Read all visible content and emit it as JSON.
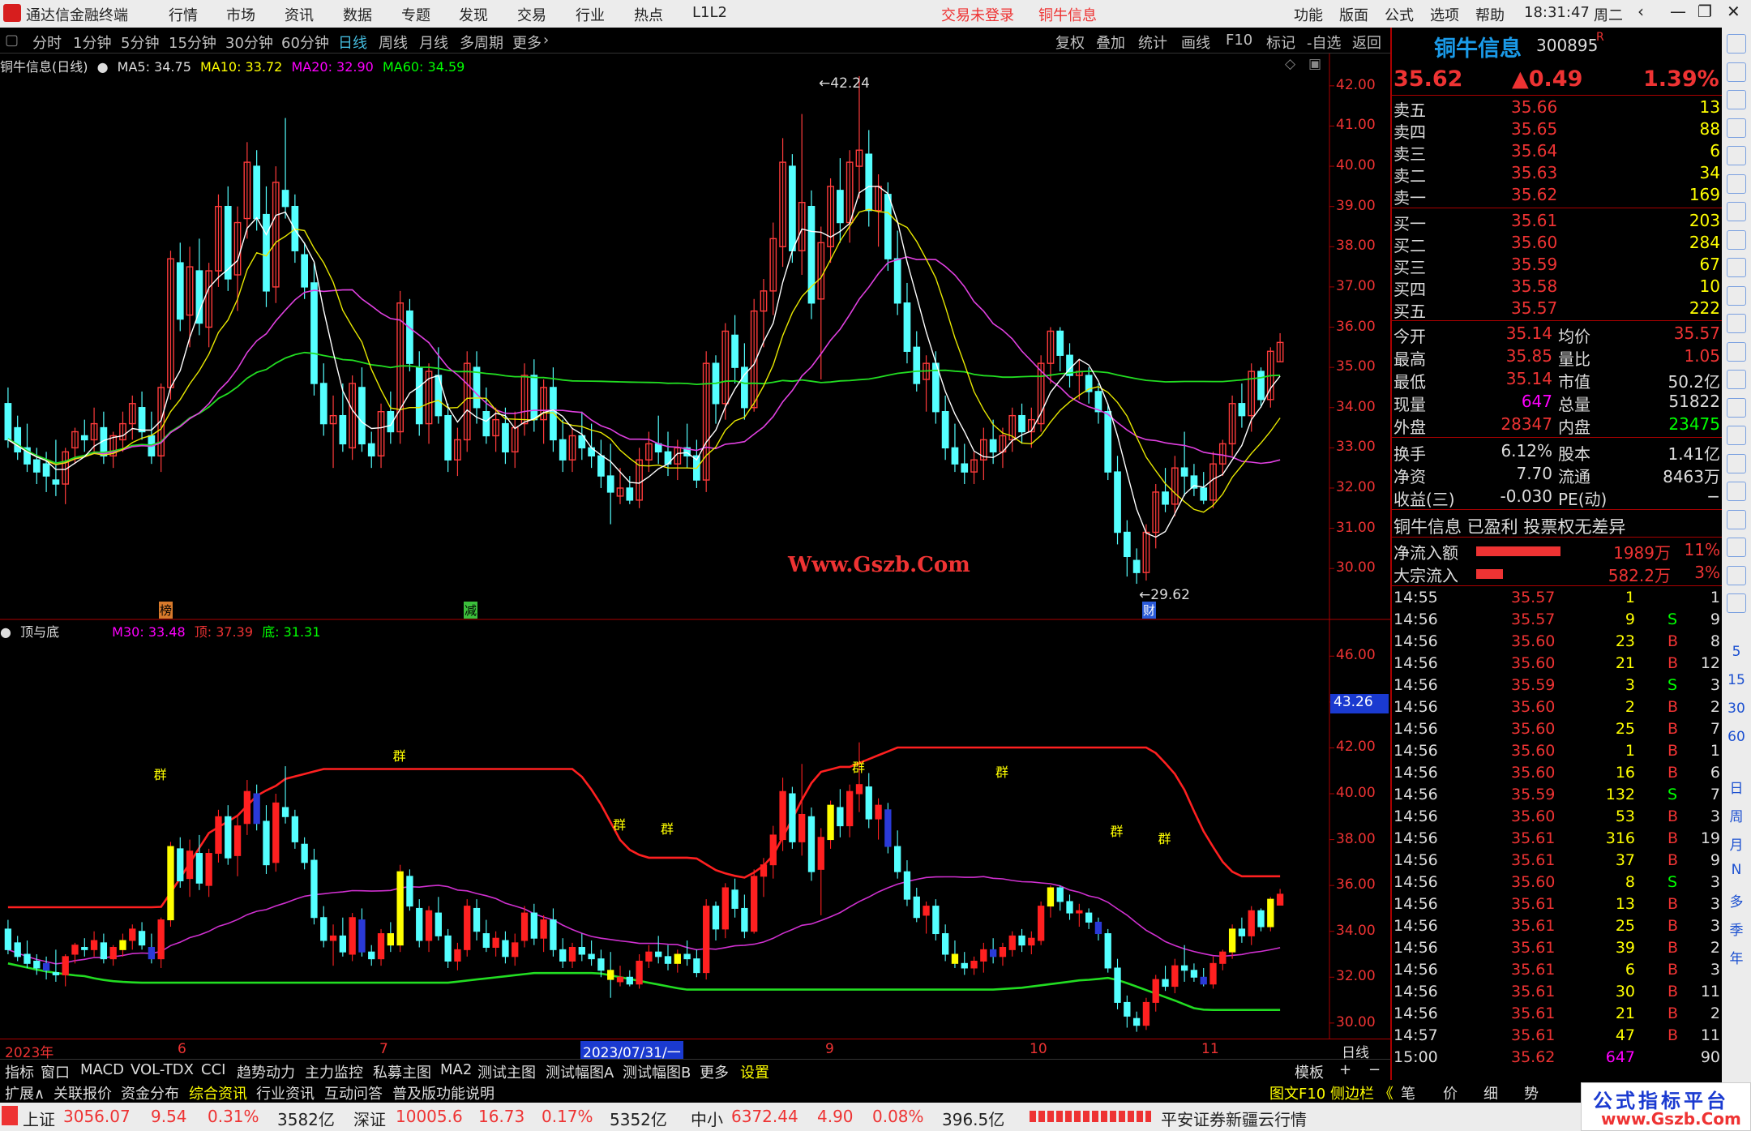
{
  "topbar": {
    "app_title": "通达信金融终端",
    "menu": [
      "行情",
      "市场",
      "资讯",
      "数据",
      "专题",
      "发现",
      "交易",
      "行业",
      "热点",
      "L1L2"
    ],
    "trade_status": "交易未登录",
    "stock_name": "铜牛信息",
    "right_menu": [
      "功能",
      "版面",
      "公式",
      "选项",
      "帮助"
    ],
    "time": "18:31:47",
    "weekday": "周二"
  },
  "periodbar": {
    "periods": [
      "分时",
      "1分钟",
      "5分钟",
      "15分钟",
      "30分钟",
      "60分钟",
      "日线",
      "周线",
      "月线",
      "多周期",
      "更多"
    ],
    "active": "日线",
    "tools": [
      "复权",
      "叠加",
      "统计",
      "画线",
      "F10",
      "标记",
      "-自选",
      "返回"
    ]
  },
  "main_chart": {
    "title": "铜牛信息(日线)",
    "ma5_label": "MA5: 34.75",
    "ma10_label": "MA10: 33.72",
    "ma20_label": "MA20: 32.90",
    "ma60_label": "MA60: 34.59",
    "high_label": "42.24",
    "low_label": "29.62",
    "watermark": "Www.Gszb.Com",
    "marker_bang": "榜",
    "marker_jian": "减",
    "marker_cai": "财",
    "yticks": [
      "42.00",
      "41.00",
      "40.00",
      "39.00",
      "38.00",
      "37.00",
      "36.00",
      "35.00",
      "34.00",
      "33.00",
      "32.00",
      "31.00",
      "30.00"
    ]
  },
  "indicator": {
    "name": "顶与底",
    "m30_label": "M30: 33.48",
    "top_label": "顶: 37.39",
    "bottom_label": "底: 31.31",
    "current_value": "43.26",
    "group_marker": "群",
    "yticks": [
      "46.00",
      "44.00",
      "42.00",
      "40.00",
      "38.00",
      "36.00",
      "34.00",
      "32.00",
      "30.00"
    ]
  },
  "xaxis": {
    "labels": [
      "2023年",
      "6",
      "7",
      "2023/07/31/一",
      "9",
      "10",
      "11"
    ],
    "period_label": "日线"
  },
  "tabs1": {
    "items": [
      "指标",
      "窗口",
      "MACD",
      "VOL-TDX",
      "CCI",
      "趋势动力",
      "主力监控",
      "私募主图",
      "MA2",
      "测试主图",
      "测试幅图A",
      "测试幅图B",
      "更多",
      "设置"
    ],
    "right": [
      "模板",
      "+",
      "−"
    ]
  },
  "tabs2": {
    "items": [
      "扩展∧",
      "关联报价",
      "资金分布",
      "综合资讯",
      "行业资讯",
      "互动问答",
      "普及版功能说明"
    ],
    "right": "图文F10 侧边栏 《",
    "quote_tabs": [
      "笔",
      "价",
      "细",
      "势"
    ]
  },
  "quote": {
    "name": "铜牛信息",
    "code": "300895",
    "flag": "R",
    "price": "35.62",
    "change": "▲0.49",
    "change_pct": "1.39%",
    "asks": [
      {
        "label": "卖五",
        "price": "35.66",
        "vol": "13"
      },
      {
        "label": "卖四",
        "price": "35.65",
        "vol": "88"
      },
      {
        "label": "卖三",
        "price": "35.64",
        "vol": "6"
      },
      {
        "label": "卖二",
        "price": "35.63",
        "vol": "34"
      },
      {
        "label": "卖一",
        "price": "35.62",
        "vol": "169"
      }
    ],
    "bids": [
      {
        "label": "买一",
        "price": "35.61",
        "vol": "203"
      },
      {
        "label": "买二",
        "price": "35.60",
        "vol": "284"
      },
      {
        "label": "买三",
        "price": "35.59",
        "vol": "67"
      },
      {
        "label": "买四",
        "price": "35.58",
        "vol": "10"
      },
      {
        "label": "买五",
        "price": "35.57",
        "vol": "222"
      }
    ],
    "stats": [
      {
        "l1": "今开",
        "v1": "35.14",
        "l2": "均价",
        "v2": "35.57"
      },
      {
        "l1": "最高",
        "v1": "35.85",
        "l2": "量比",
        "v2": "1.05"
      },
      {
        "l1": "最低",
        "v1": "35.14",
        "l2": "市值",
        "v2": "50.2亿"
      },
      {
        "l1": "现量",
        "v1": "647",
        "l2": "总量",
        "v2": "51822"
      },
      {
        "l1": "外盘",
        "v1": "28347",
        "l2": "内盘",
        "v2": "23475"
      }
    ],
    "stats2": [
      {
        "l1": "换手",
        "v1": "6.12%",
        "l2": "股本",
        "v2": "1.41亿"
      },
      {
        "l1": "净资",
        "v1": "7.70",
        "l2": "流通",
        "v2": "8463万"
      },
      {
        "l1": "收益(三)",
        "v1": "-0.030",
        "l2": "PE(动)",
        "v2": "−"
      }
    ],
    "tagline": "铜牛信息 已盈利 投票权无差异",
    "flows": [
      {
        "label": "净流入额",
        "value": "1989万",
        "pct": "11%",
        "bar": 0.8
      },
      {
        "label": "大宗流入",
        "value": "582.2万",
        "pct": "3%",
        "bar": 0.25
      }
    ],
    "ticks": [
      {
        "t": "14:55",
        "p": "35.57",
        "v": "1",
        "s": "",
        "n": "1"
      },
      {
        "t": "14:56",
        "p": "35.57",
        "v": "9",
        "s": "S",
        "n": "9"
      },
      {
        "t": "14:56",
        "p": "35.60",
        "v": "23",
        "s": "B",
        "n": "8"
      },
      {
        "t": "14:56",
        "p": "35.60",
        "v": "21",
        "s": "B",
        "n": "12"
      },
      {
        "t": "14:56",
        "p": "35.59",
        "v": "3",
        "s": "S",
        "n": "3"
      },
      {
        "t": "14:56",
        "p": "35.60",
        "v": "2",
        "s": "B",
        "n": "2"
      },
      {
        "t": "14:56",
        "p": "35.60",
        "v": "25",
        "s": "B",
        "n": "7"
      },
      {
        "t": "14:56",
        "p": "35.60",
        "v": "1",
        "s": "B",
        "n": "1"
      },
      {
        "t": "14:56",
        "p": "35.60",
        "v": "16",
        "s": "B",
        "n": "6"
      },
      {
        "t": "14:56",
        "p": "35.59",
        "v": "132",
        "s": "S",
        "n": "7"
      },
      {
        "t": "14:56",
        "p": "35.60",
        "v": "53",
        "s": "B",
        "n": "3"
      },
      {
        "t": "14:56",
        "p": "35.61",
        "v": "316",
        "s": "B",
        "n": "19"
      },
      {
        "t": "14:56",
        "p": "35.61",
        "v": "37",
        "s": "B",
        "n": "9"
      },
      {
        "t": "14:56",
        "p": "35.60",
        "v": "8",
        "s": "S",
        "n": "3"
      },
      {
        "t": "14:56",
        "p": "35.61",
        "v": "13",
        "s": "B",
        "n": "3"
      },
      {
        "t": "14:56",
        "p": "35.61",
        "v": "25",
        "s": "B",
        "n": "3"
      },
      {
        "t": "14:56",
        "p": "35.61",
        "v": "39",
        "s": "B",
        "n": "2"
      },
      {
        "t": "14:56",
        "p": "35.61",
        "v": "6",
        "s": "B",
        "n": "3"
      },
      {
        "t": "14:56",
        "p": "35.61",
        "v": "30",
        "s": "B",
        "n": "11"
      },
      {
        "t": "14:56",
        "p": "35.61",
        "v": "21",
        "s": "B",
        "n": "2"
      },
      {
        "t": "14:57",
        "p": "35.61",
        "v": "47",
        "s": "B",
        "n": "11"
      },
      {
        "t": "15:00",
        "p": "35.62",
        "v": "647",
        "s": "",
        "n": "90"
      }
    ]
  },
  "right_strip": [
    "日",
    "周",
    "月",
    "N",
    "多",
    "季",
    "年"
  ],
  "right_strip_nums": [
    "5",
    "15",
    "30",
    "60"
  ],
  "statusbar": {
    "sh_label": "上证",
    "sh_value": "3056.07",
    "sh_chg": "9.54",
    "sh_pct": "0.31%",
    "sh_amt": "3582亿",
    "sz_label": "深证",
    "sz_value": "10005.6",
    "sz_chg": "16.73",
    "sz_pct": "0.17%",
    "sz_amt": "5352亿",
    "zx_label": "中小",
    "zx_value": "6372.44",
    "zx_chg": "4.90",
    "zx_pct": "0.08%",
    "zx_amt": "396.5亿",
    "broker": "平安证券新疆云行情",
    "watermark_text": "公式指标平台",
    "watermark_url": "www.Gszb.Com"
  },
  "chart_data": {
    "type": "candlestick",
    "main": {
      "ylim": [
        29.5,
        42.4
      ],
      "candles": [
        [
          34.1,
          34.5,
          33.0,
          33.2
        ],
        [
          33.5,
          33.8,
          32.7,
          32.9
        ],
        [
          33.0,
          33.6,
          32.4,
          32.6
        ],
        [
          32.7,
          33.0,
          32.1,
          32.4
        ],
        [
          32.6,
          32.9,
          31.9,
          32.3
        ],
        [
          32.2,
          33.2,
          31.8,
          32.1
        ],
        [
          32.1,
          33.0,
          31.6,
          32.9
        ],
        [
          33.0,
          33.5,
          32.6,
          33.4
        ],
        [
          33.3,
          33.7,
          32.9,
          33.2
        ],
        [
          33.2,
          34.0,
          32.9,
          33.6
        ],
        [
          33.5,
          33.9,
          32.6,
          32.8
        ],
        [
          32.8,
          33.4,
          32.5,
          33.3
        ],
        [
          33.2,
          33.9,
          32.9,
          33.6
        ],
        [
          33.6,
          34.3,
          33.2,
          34.1
        ],
        [
          34.0,
          34.4,
          33.2,
          33.4
        ],
        [
          33.3,
          33.9,
          32.6,
          32.8
        ],
        [
          32.8,
          34.6,
          32.4,
          34.5
        ],
        [
          34.5,
          37.9,
          34.2,
          37.7
        ],
        [
          37.6,
          38.1,
          35.9,
          36.2
        ],
        [
          36.3,
          38.0,
          35.5,
          37.5
        ],
        [
          37.4,
          38.2,
          35.8,
          36.1
        ],
        [
          36.0,
          37.6,
          35.5,
          37.4
        ],
        [
          37.4,
          39.3,
          37.0,
          39.0
        ],
        [
          39.0,
          39.5,
          36.9,
          37.2
        ],
        [
          37.3,
          39.0,
          36.4,
          38.6
        ],
        [
          38.7,
          40.6,
          38.2,
          40.1
        ],
        [
          40.0,
          40.4,
          38.4,
          38.7
        ],
        [
          38.8,
          39.5,
          36.5,
          36.9
        ],
        [
          37.0,
          40.0,
          36.6,
          39.6
        ],
        [
          39.4,
          41.2,
          38.7,
          39.0
        ],
        [
          39.0,
          39.3,
          37.6,
          37.9
        ],
        [
          37.8,
          38.1,
          36.7,
          37.0
        ],
        [
          37.1,
          37.6,
          34.3,
          34.6
        ],
        [
          34.6,
          35.1,
          33.3,
          33.6
        ],
        [
          33.6,
          34.3,
          32.5,
          33.8
        ],
        [
          33.8,
          34.6,
          32.9,
          33.1
        ],
        [
          33.0,
          34.8,
          32.7,
          34.6
        ],
        [
          34.5,
          35.0,
          32.9,
          33.1
        ],
        [
          33.1,
          33.4,
          32.5,
          32.8
        ],
        [
          32.8,
          34.1,
          32.5,
          33.9
        ],
        [
          33.9,
          34.4,
          33.1,
          33.4
        ],
        [
          33.4,
          36.9,
          33.1,
          36.6
        ],
        [
          36.4,
          36.7,
          34.9,
          35.1
        ],
        [
          35.0,
          35.4,
          33.3,
          33.6
        ],
        [
          33.6,
          35.1,
          33.1,
          34.9
        ],
        [
          34.8,
          35.5,
          33.6,
          33.8
        ],
        [
          33.8,
          34.1,
          32.4,
          32.7
        ],
        [
          32.7,
          33.5,
          32.3,
          33.2
        ],
        [
          33.2,
          35.4,
          32.9,
          35.1
        ],
        [
          35.0,
          35.4,
          33.6,
          34.0
        ],
        [
          33.9,
          34.5,
          33.1,
          33.3
        ],
        [
          33.3,
          34.0,
          32.9,
          33.7
        ],
        [
          33.6,
          34.0,
          32.6,
          32.9
        ],
        [
          32.9,
          33.9,
          32.5,
          33.5
        ],
        [
          33.6,
          35.1,
          33.3,
          34.8
        ],
        [
          34.8,
          35.2,
          33.4,
          33.7
        ],
        [
          33.7,
          34.7,
          33.1,
          34.5
        ],
        [
          34.5,
          35.0,
          32.9,
          33.2
        ],
        [
          33.2,
          33.7,
          32.4,
          32.7
        ],
        [
          32.7,
          33.5,
          32.4,
          33.3
        ],
        [
          33.3,
          33.9,
          32.7,
          33.0
        ],
        [
          33.0,
          33.6,
          32.5,
          32.8
        ],
        [
          32.8,
          33.2,
          32.0,
          32.3
        ],
        [
          32.3,
          33.1,
          31.1,
          31.9
        ],
        [
          31.8,
          32.5,
          31.6,
          32.0
        ],
        [
          32.0,
          32.3,
          31.6,
          31.7
        ],
        [
          31.7,
          33.0,
          31.5,
          32.7
        ],
        [
          32.7,
          33.4,
          32.4,
          33.1
        ],
        [
          33.1,
          33.8,
          32.6,
          32.9
        ],
        [
          32.9,
          33.4,
          32.3,
          32.6
        ],
        [
          32.6,
          33.2,
          32.2,
          33.0
        ],
        [
          33.0,
          33.6,
          32.5,
          32.8
        ],
        [
          32.8,
          33.2,
          32.0,
          32.2
        ],
        [
          32.2,
          35.4,
          31.9,
          35.1
        ],
        [
          35.1,
          35.3,
          33.6,
          34.1
        ],
        [
          34.1,
          36.1,
          33.7,
          35.9
        ],
        [
          35.8,
          36.3,
          34.6,
          35.0
        ],
        [
          35.0,
          35.6,
          33.7,
          34.0
        ],
        [
          34.0,
          36.7,
          33.9,
          36.4
        ],
        [
          36.4,
          37.2,
          35.5,
          36.9
        ],
        [
          36.9,
          38.6,
          36.3,
          38.2
        ],
        [
          38.0,
          40.7,
          37.5,
          40.1
        ],
        [
          40.0,
          40.3,
          37.6,
          37.9
        ],
        [
          37.9,
          41.3,
          37.3,
          39.1
        ],
        [
          39.0,
          39.4,
          36.2,
          36.6
        ],
        [
          36.7,
          38.5,
          34.7,
          38.1
        ],
        [
          38.0,
          39.7,
          37.6,
          39.5
        ],
        [
          39.4,
          40.2,
          38.1,
          38.6
        ],
        [
          38.6,
          40.4,
          38.1,
          40.1
        ],
        [
          40.0,
          42.24,
          39.2,
          40.4
        ],
        [
          40.3,
          40.9,
          38.5,
          38.9
        ],
        [
          38.9,
          39.8,
          38.0,
          39.5
        ],
        [
          39.3,
          39.6,
          37.4,
          37.7
        ],
        [
          37.7,
          38.4,
          36.3,
          36.6
        ],
        [
          36.6,
          37.1,
          35.1,
          35.4
        ],
        [
          35.5,
          35.9,
          34.4,
          34.6
        ],
        [
          34.7,
          35.3,
          33.9,
          35.1
        ],
        [
          35.1,
          35.4,
          33.6,
          33.9
        ],
        [
          33.9,
          34.3,
          32.7,
          33.0
        ],
        [
          33.0,
          33.6,
          32.4,
          32.6
        ],
        [
          32.6,
          33.1,
          32.1,
          32.4
        ],
        [
          32.4,
          32.9,
          32.1,
          32.7
        ],
        [
          32.7,
          33.5,
          32.2,
          33.2
        ],
        [
          33.2,
          33.7,
          32.6,
          32.9
        ],
        [
          32.9,
          33.5,
          32.5,
          33.3
        ],
        [
          33.2,
          34.0,
          32.9,
          33.8
        ],
        [
          33.8,
          34.1,
          33.1,
          33.4
        ],
        [
          33.4,
          34.0,
          33.0,
          33.7
        ],
        [
          33.6,
          35.3,
          33.4,
          35.1
        ],
        [
          35.1,
          36.0,
          34.6,
          35.9
        ],
        [
          35.9,
          36.0,
          34.9,
          35.3
        ],
        [
          35.3,
          35.6,
          34.5,
          34.8
        ],
        [
          34.8,
          35.2,
          34.2,
          34.9
        ],
        [
          34.8,
          35.0,
          34.1,
          34.4
        ],
        [
          34.4,
          34.6,
          33.6,
          33.9
        ],
        [
          33.9,
          34.1,
          32.2,
          32.4
        ],
        [
          32.4,
          32.8,
          30.6,
          30.9
        ],
        [
          30.9,
          31.2,
          29.8,
          30.3
        ],
        [
          30.2,
          30.5,
          29.62,
          29.9
        ],
        [
          29.9,
          31.1,
          29.7,
          30.9
        ],
        [
          30.9,
          32.1,
          30.5,
          31.9
        ],
        [
          31.9,
          32.5,
          31.4,
          31.6
        ],
        [
          31.6,
          32.8,
          31.3,
          32.5
        ],
        [
          32.5,
          33.4,
          31.8,
          32.3
        ],
        [
          32.3,
          32.6,
          31.8,
          32.0
        ],
        [
          32.0,
          32.4,
          31.6,
          31.7
        ],
        [
          31.7,
          32.9,
          31.5,
          32.6
        ],
        [
          32.6,
          33.2,
          32.3,
          33.1
        ],
        [
          33.1,
          34.3,
          32.8,
          34.1
        ],
        [
          34.1,
          34.6,
          33.5,
          33.8
        ],
        [
          33.8,
          35.1,
          33.4,
          34.9
        ],
        [
          34.9,
          35.0,
          34.0,
          34.2
        ],
        [
          34.2,
          35.5,
          34.0,
          35.4
        ],
        [
          35.14,
          35.85,
          35.14,
          35.62
        ]
      ]
    },
    "indicator": {
      "ylim": [
        29.5,
        47.0
      ]
    }
  }
}
